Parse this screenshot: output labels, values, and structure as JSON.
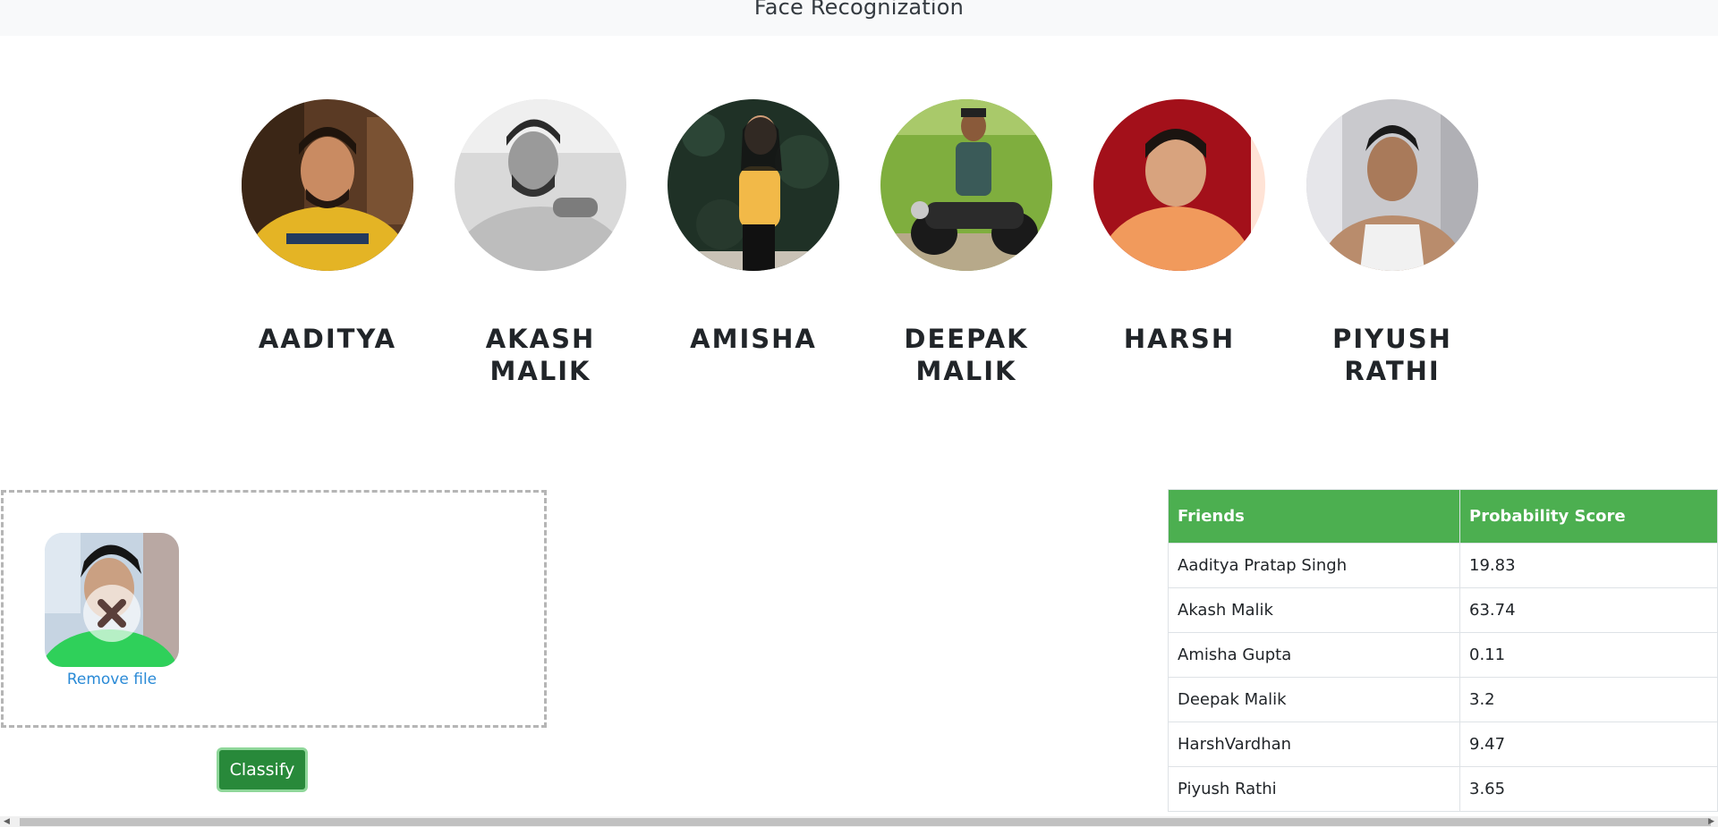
{
  "header": {
    "title": "Face Recognization"
  },
  "friends": [
    {
      "name": "AADITYA"
    },
    {
      "name": "AKASH MALIK"
    },
    {
      "name": "AMISHA"
    },
    {
      "name": "DEEPAK MALIK"
    },
    {
      "name": "HARSH"
    },
    {
      "name": "PIYUSH RATHI"
    }
  ],
  "upload": {
    "remove_label": "Remove file",
    "remove_icon": "close-icon"
  },
  "classify_label": "Classify",
  "results": {
    "headers": [
      "Friends",
      "Probability Score"
    ],
    "rows": [
      {
        "friend": "Aaditya Pratap Singh",
        "score": "19.83"
      },
      {
        "friend": "Akash Malik",
        "score": "63.74"
      },
      {
        "friend": "Amisha Gupta",
        "score": "0.11"
      },
      {
        "friend": "Deepak Malik",
        "score": "3.2"
      },
      {
        "friend": "HarshVardhan",
        "score": "9.47"
      },
      {
        "friend": "Piyush Rathi",
        "score": "3.65"
      }
    ]
  },
  "colors": {
    "table_header": "#4caf50",
    "classify_button": "#28893a",
    "link": "#2a8ad6"
  }
}
